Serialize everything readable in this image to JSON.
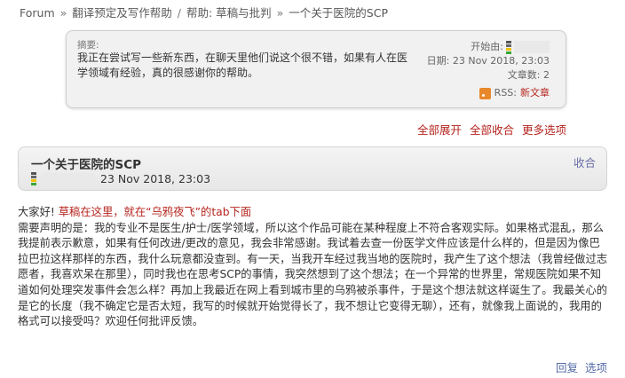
{
  "breadcrumb": {
    "forum": "Forum",
    "sep": "»",
    "section1": "翻译预定及写作帮助",
    "slash": "/",
    "section2": "帮助: 草稿与批判",
    "current": "一个关于医院的SCP"
  },
  "summary": {
    "label": "摘要:",
    "text": "我正在尝试写一些新东西，在聊天里他们说这个很不错，如果有人在医学领域有经验，真的很感谢你的帮助。",
    "starter_label": "开始由:",
    "date_label": "日期:",
    "date_value": "23 Nov 2018, 23:03",
    "count_label": "文章数:",
    "count_value": "2",
    "rss_label": "RSS:",
    "rss_link": "新文章"
  },
  "actions": {
    "expand_all": "全部展开",
    "collapse_all": "全部收合",
    "more_options": "更多选项"
  },
  "post": {
    "title": "一个关于医院的SCP",
    "collapse": "收合",
    "date": "23 Nov 2018, 23:03",
    "greeting": "大家好!",
    "highlight": "草稿在这里，就在“乌鸦夜飞”的tab下面",
    "body": "需要声明的是：我的专业不是医生/护士/医学领域，所以这个作品可能在某种程度上不符合客观实际。如果格式混乱，那么我提前表示歉意，如果有任何改进/更改的意见，我会非常感谢。我试着去查一份医学文件应该是什么样的，但是因为像巴拉巴拉这样那样的东西，我什么玩意都没查到。有一天，当我开车经过我当地的医院时，我产生了这个想法（我曾经做过志愿者，我喜欢呆在那里），同时我也在思考SCP的事情，我突然想到了这个想法；在一个异常的世界里，常规医院如果不知道如何处理突发事件会怎么样？再加上我最近在网上看到城市里的乌鸦被杀事件，于是这个想法就这样诞生了。我最关心的是它的长度（我不确定它是否太短，我写的时候就开始觉得长了，我不想让它变得无聊），还有，就像我上面说的，我用的格式可以接受吗？欢迎任何批评反馈。",
    "reply": "回复",
    "options": "选项"
  },
  "colors": {
    "link_red": "#b5251f",
    "link_blue": "#556aa8",
    "collapse_purple": "#6b6fa5"
  }
}
